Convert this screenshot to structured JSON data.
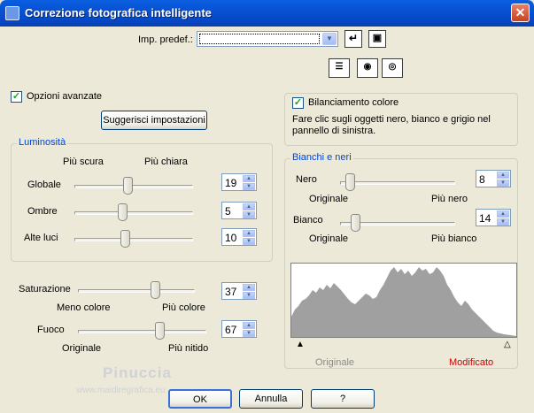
{
  "window": {
    "title": "Correzione fotografica intelligente",
    "close_glyph": "✕",
    "icon": "app-icon"
  },
  "preset": {
    "label": "Imp. predef.:",
    "value": "",
    "reset_icon": "reset-arrow-icon",
    "save_icon": "save-disk-icon"
  },
  "view_buttons": [
    "split-view-icon",
    "eye-dropper-icon",
    "eye-icon"
  ],
  "advanced": {
    "label": "Opzioni avanzate",
    "checked": true,
    "suggest_button": "Suggerisci impostazioni"
  },
  "brightness": {
    "title": "Luminosità",
    "darker": "Più scura",
    "lighter": "Più chiara",
    "rows": [
      {
        "label": "Globale",
        "value": "19",
        "level": 0.45
      },
      {
        "label": "Ombre",
        "value": "5",
        "level": 0.4
      },
      {
        "label": "Alte luci",
        "value": "10",
        "level": 0.42
      }
    ]
  },
  "saturation": {
    "label": "Saturazione",
    "value": "37",
    "level": 0.68,
    "min_label": "Meno colore",
    "max_label": "Più colore"
  },
  "focus": {
    "label": "Fuoco",
    "value": "67",
    "level": 0.65,
    "min_label": "Originale",
    "max_label": "Più nitido"
  },
  "color_balance": {
    "label": "Bilanciamento colore",
    "checked": true,
    "description_line1": "Fare clic sugli oggetti nero, bianco e grigio nel",
    "description_line2": "pannello di sinistra."
  },
  "black_white": {
    "title": "Bianchi e neri",
    "black": {
      "label": "Nero",
      "value": "8",
      "level": 0.05,
      "min_label": "Originale",
      "max_label": "Più nero"
    },
    "white": {
      "label": "Bianco",
      "value": "14",
      "level": 0.1,
      "min_label": "Originale",
      "max_label": "Più bianco"
    }
  },
  "histogram": {
    "original_label": "Originale",
    "modified_label": "Modificato",
    "modified_color": "#cc0000",
    "original_color": "#8a8a8a",
    "fill_color": "#a0a0a0",
    "black_marker": "▲",
    "white_marker": "△"
  },
  "watermark": {
    "name": "Pinuccia",
    "url": "www.maidiregrafica.eu"
  },
  "buttons": {
    "ok": "OK",
    "cancel": "Annulla",
    "help": "?"
  }
}
